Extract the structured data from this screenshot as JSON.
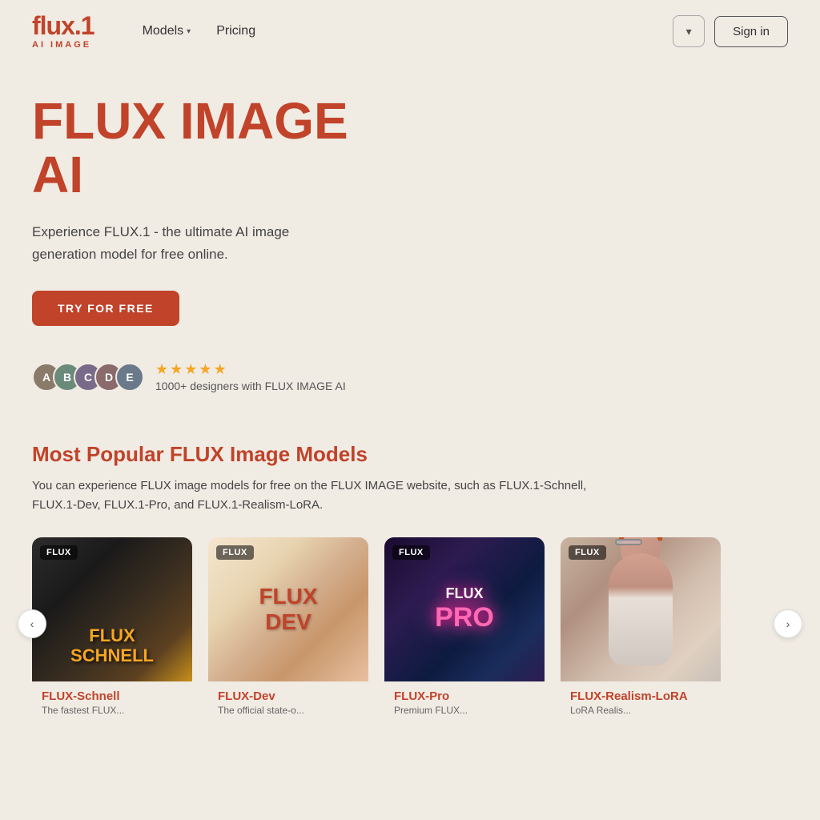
{
  "site": {
    "logo_main": "flux.1",
    "logo_sub": "AI IMAGE"
  },
  "nav": {
    "models_label": "Models",
    "pricing_label": "Pricing"
  },
  "header_actions": {
    "lang_chevron": "▾",
    "signin_label": "Sign in"
  },
  "hero": {
    "title_line1": "FLUX IMAGE",
    "title_line2": "AI",
    "description": "Experience FLUX.1 - the ultimate AI image generation model for free online.",
    "cta_label": "TRY FOR FREE"
  },
  "social_proof": {
    "stars": [
      "★",
      "★",
      "★",
      "★",
      "★"
    ],
    "text": "1000+ designers with FLUX IMAGE AI"
  },
  "models_section": {
    "title": "Most Popular FLUX Image Models",
    "description": "You can experience FLUX image models for free on the FLUX IMAGE website, such as FLUX.1-Schnell, FLUX.1-Dev, FLUX.1-Pro, and FLUX.1-Realism-LoRA.",
    "cards": [
      {
        "badge": "FLUX",
        "name": "FLUX-Schnell",
        "tagline": "The fastest FLUX...",
        "type": "schnell"
      },
      {
        "badge": "FLUX",
        "name": "FLUX-Dev",
        "tagline": "The official state-o...",
        "type": "dev"
      },
      {
        "badge": "FLUX",
        "name": "FLUX-Pro",
        "tagline": "Premium FLUX...",
        "type": "pro"
      },
      {
        "badge": "FLUX",
        "name": "FLUX-Realism-LoRA",
        "tagline": "LoRA Realis...",
        "type": "realism"
      }
    ]
  }
}
